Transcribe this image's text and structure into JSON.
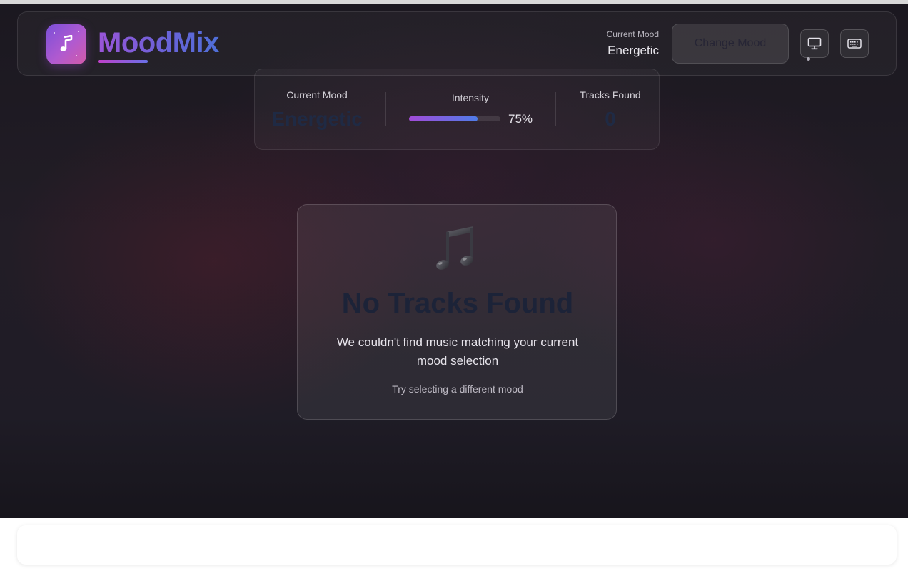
{
  "app": {
    "name": "MoodMix",
    "brand_colors": {
      "gradient_start": "#9a55d8",
      "gradient_end": "#4f6fd8"
    }
  },
  "header": {
    "current_mood_label": "Current Mood",
    "current_mood_value": "Energetic",
    "change_mood_label": "Change Mood",
    "icons": {
      "logo": "music-note-icon",
      "display": "monitor-icon",
      "keyboard": "keyboard-icon"
    }
  },
  "stats": {
    "mood_label": "Current Mood",
    "mood_value": "Energetic",
    "intensity_label": "Intensity",
    "intensity_percent": "75%",
    "intensity_fraction": 0.75,
    "tracks_label": "Tracks Found",
    "tracks_value": "0"
  },
  "empty_state": {
    "icon": "music-notes-icon",
    "title": "No Tracks Found",
    "message": "We couldn't find music matching your current mood selection",
    "hint": "Try selecting a different mood"
  }
}
